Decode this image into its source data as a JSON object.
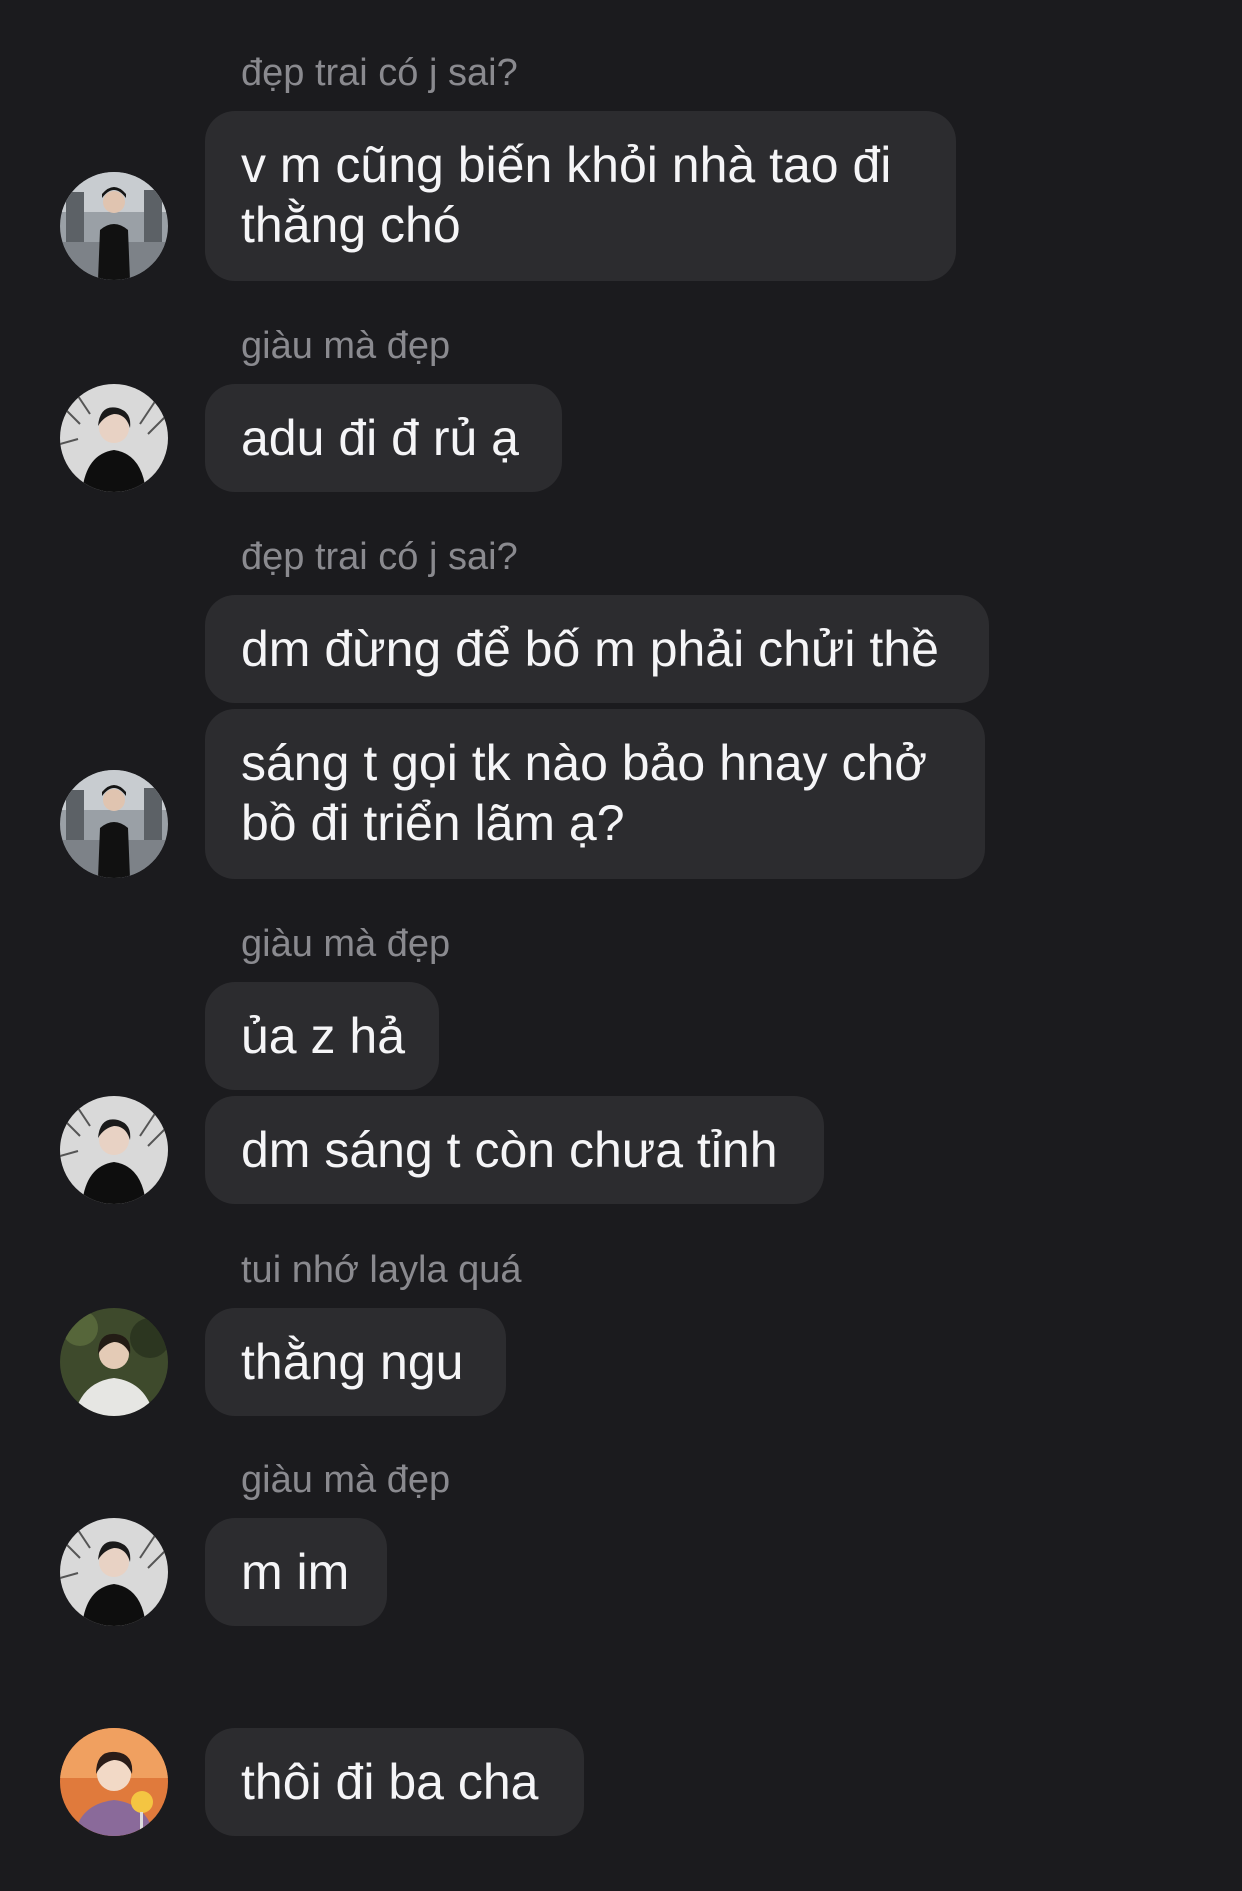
{
  "messages": [
    {
      "sender": "đẹp trai có j sai?",
      "lines": [
        "v m cũng biến khỏi nhà tao đi",
        "thằng chó"
      ]
    },
    {
      "sender": "giàu mà đẹp",
      "lines": [
        "adu đi đ rủ ạ"
      ]
    },
    {
      "sender": "đẹp trai có j sai?",
      "lines": [
        "dm đừng để bố m phải chửi thề"
      ]
    },
    {
      "sender": "",
      "lines": [
        "sáng t gọi tk nào bảo hnay chở",
        "bồ đi triển lãm ạ?"
      ]
    },
    {
      "sender": "giàu mà đẹp",
      "lines": [
        "ủa z hả"
      ]
    },
    {
      "sender": "",
      "lines": [
        "dm sáng t còn chưa tỉnh"
      ]
    },
    {
      "sender": "tui nhớ layla quá",
      "lines": [
        "thằng ngu"
      ]
    },
    {
      "sender": "giàu mà đẹp",
      "lines": [
        "m im"
      ]
    },
    {
      "sender": "",
      "lines": [
        "thôi đi ba cha"
      ]
    }
  ],
  "avatars": [
    {
      "icon": "avatar-suit-man-icon"
    },
    {
      "icon": "avatar-black-shirt-man-icon"
    },
    {
      "icon": "avatar-suit-man-icon"
    },
    {
      "icon": "avatar-black-shirt-man-icon"
    },
    {
      "icon": "avatar-white-shirt-man-icon"
    },
    {
      "icon": "avatar-black-shirt-man-icon"
    },
    {
      "icon": "avatar-colorful-man-icon"
    }
  ],
  "colors": {
    "background": "#1b1b1e",
    "bubble": "#2c2c2f",
    "sender_text": "#8a8a8f",
    "message_text": "#f5f5f7"
  }
}
